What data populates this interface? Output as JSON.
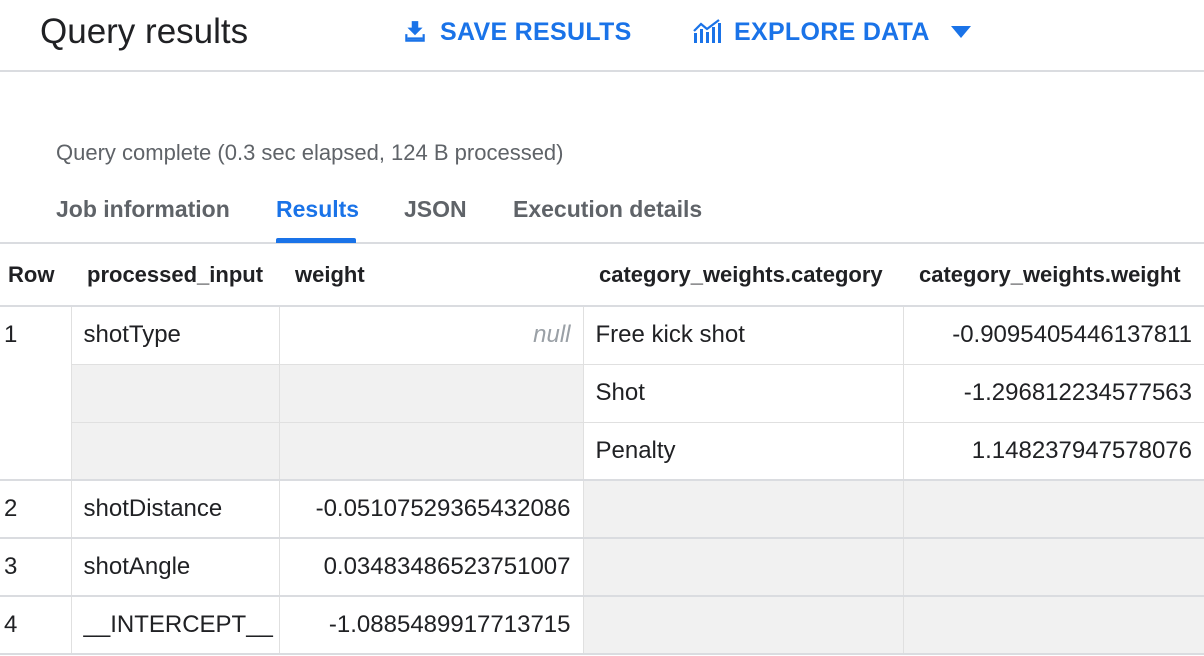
{
  "header": {
    "title": "Query results",
    "save_label": "SAVE RESULTS",
    "explore_label": "EXPLORE DATA"
  },
  "status": "Query complete (0.3 sec elapsed, 124 B processed)",
  "tabs": [
    {
      "label": "Job information",
      "active": false
    },
    {
      "label": "Results",
      "active": true
    },
    {
      "label": "JSON",
      "active": false
    },
    {
      "label": "Execution details",
      "active": false
    }
  ],
  "table": {
    "columns": [
      "Row",
      "processed_input",
      "weight",
      "category_weights.category",
      "category_weights.weight"
    ],
    "rows": [
      {
        "row": "1",
        "processed_input": "shotType",
        "weight": "null",
        "categories": [
          {
            "category": "Free kick shot",
            "weight": "-0.9095405446137811"
          },
          {
            "category": "Shot",
            "weight": "-1.296812234577563"
          },
          {
            "category": "Penalty",
            "weight": "1.148237947578076"
          }
        ]
      },
      {
        "row": "2",
        "processed_input": "shotDistance",
        "weight": "-0.05107529365432086"
      },
      {
        "row": "3",
        "processed_input": "shotAngle",
        "weight": "0.03483486523751007"
      },
      {
        "row": "4",
        "processed_input": "__INTERCEPT__",
        "weight": "-1.0885489917713715"
      }
    ]
  },
  "colors": {
    "accent": "#1a73e8",
    "text": "#202124",
    "muted": "#5f6368",
    "empty_cell": "#f1f1f1"
  },
  "icons": {
    "save": "download-icon",
    "explore": "chart-icon",
    "dropdown": "caret-down-icon"
  }
}
